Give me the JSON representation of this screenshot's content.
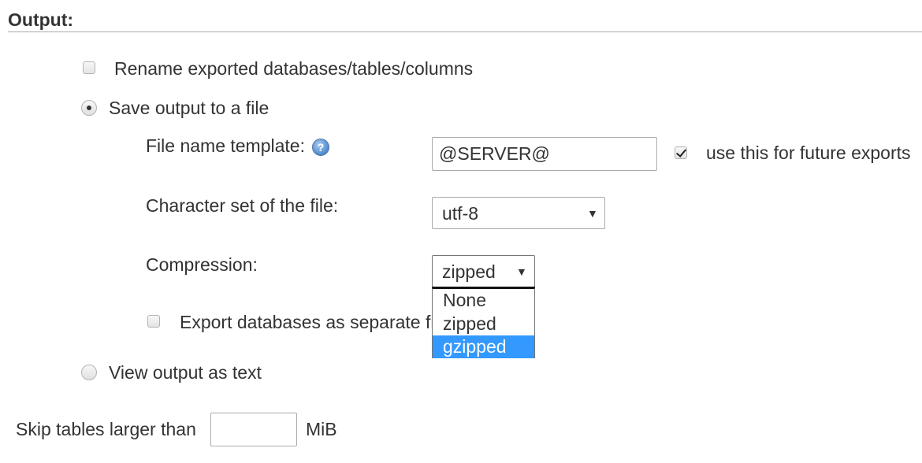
{
  "section": {
    "title": "Output:"
  },
  "rename": {
    "label": "Rename exported databases/tables/columns",
    "checked": false
  },
  "save_to_file": {
    "label": "Save output to a file",
    "selected": true
  },
  "file_name_template": {
    "label": "File name template:",
    "help_icon": "help-icon",
    "value": "@SERVER@",
    "future_label": "use this for future exports",
    "future_checked": true
  },
  "charset": {
    "label": "Character set of the file:",
    "value": "utf-8"
  },
  "compression": {
    "label": "Compression:",
    "value": "zipped",
    "options": [
      "None",
      "zipped",
      "gzipped"
    ],
    "highlighted": "gzipped"
  },
  "separate_files": {
    "label": "Export databases as separate fi",
    "checked": false
  },
  "view_as_text": {
    "label": "View output as text",
    "selected": false
  },
  "skip_tables": {
    "label": "Skip tables larger than",
    "value": "",
    "unit": "MiB"
  },
  "colors": {
    "highlight": "#3399ff",
    "text": "#333333"
  }
}
